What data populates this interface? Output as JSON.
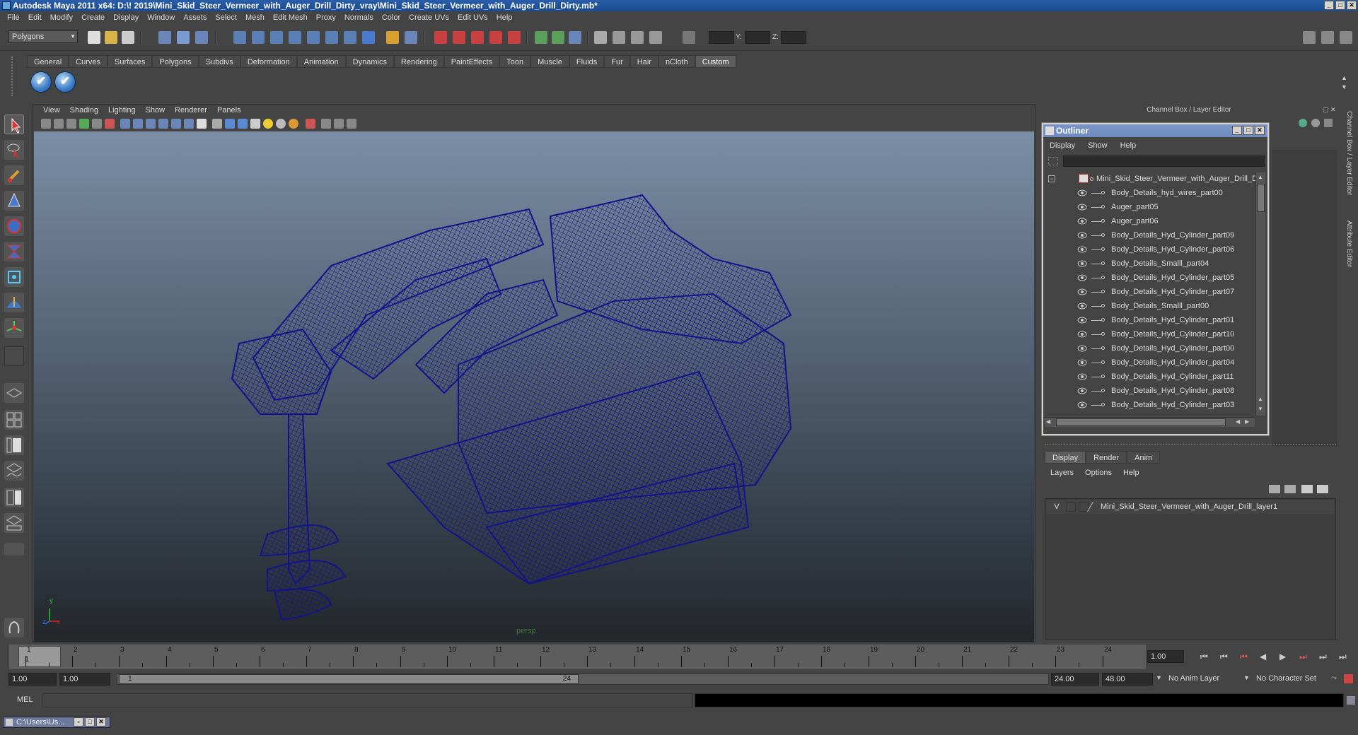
{
  "window": {
    "title": "Autodesk Maya 2011 x64: D:\\! 2019\\Mini_Skid_Steer_Vermeer_with_Auger_Drill_Dirty_vray\\Mini_Skid_Steer_Vermeer_with_Auger_Drill_Dirty.mb*"
  },
  "menubar": [
    "File",
    "Edit",
    "Modify",
    "Create",
    "Display",
    "Window",
    "Assets",
    "Select",
    "Mesh",
    "Edit Mesh",
    "Proxy",
    "Normals",
    "Color",
    "Create UVs",
    "Edit UVs",
    "Help"
  ],
  "statusline": {
    "mode": "Polygons",
    "x_label": "X:",
    "y_label": "Y:",
    "z_label": "Z:"
  },
  "shelf": {
    "tabs": [
      "General",
      "Curves",
      "Surfaces",
      "Polygons",
      "Subdivs",
      "Deformation",
      "Animation",
      "Dynamics",
      "Rendering",
      "PaintEffects",
      "Toon",
      "Muscle",
      "Fluids",
      "Fur",
      "Hair",
      "nCloth",
      "Custom"
    ],
    "active_tab": "Custom"
  },
  "viewport": {
    "menu": [
      "View",
      "Shading",
      "Lighting",
      "Show",
      "Renderer",
      "Panels"
    ],
    "camera_label": "persp",
    "axis_y": "y",
    "axis_z": "z",
    "axis_x": "x",
    "wire_color": "#14148a"
  },
  "channel_box": {
    "header": "Channel Box / Layer Editor"
  },
  "outliner": {
    "title": "Outliner",
    "menu": [
      "Display",
      "Show",
      "Help"
    ],
    "root": "Mini_Skid_Steer_Vermeer_with_Auger_Drill_Di",
    "items": [
      "Body_Details_hyd_wires_part00",
      "Auger_part05",
      "Auger_part06",
      "Body_Details_Hyd_Cylinder_part09",
      "Body_Details_Hyd_Cylinder_part06",
      "Body_Details_Smalll_part04",
      "Body_Details_Hyd_Cylinder_part05",
      "Body_Details_Hyd_Cylinder_part07",
      "Body_Details_Smalll_part00",
      "Body_Details_Hyd_Cylinder_part01",
      "Body_Details_Hyd_Cylinder_part10",
      "Body_Details_Hyd_Cylinder_part00",
      "Body_Details_Hyd_Cylinder_part04",
      "Body_Details_Hyd_Cylinder_part11",
      "Body_Details_Hyd_Cylinder_part08",
      "Body_Details_Hyd_Cylinder_part03"
    ]
  },
  "layer_editor": {
    "tabs": [
      "Display",
      "Render",
      "Anim"
    ],
    "active_tab": "Display",
    "menu": [
      "Layers",
      "Options",
      "Help"
    ],
    "layer_visible": "V",
    "layer_name": "Mini_Skid_Steer_Vermeer_with_Auger_Drill_layer1"
  },
  "side_tabs": {
    "channel_box": "Channel Box / Layer Editor",
    "attribute_editor": "Attribute Editor"
  },
  "timeline": {
    "frames": [
      "1",
      "2",
      "3",
      "4",
      "5",
      "6",
      "7",
      "8",
      "9",
      "10",
      "11",
      "12",
      "13",
      "14",
      "15",
      "16",
      "17",
      "18",
      "19",
      "20",
      "21",
      "22",
      "23",
      "24"
    ],
    "current_frame_marker": "1",
    "current_time": "1.00"
  },
  "range": {
    "start": "1.00",
    "playback_start": "1.00",
    "handle_start": "1",
    "handle_end": "24",
    "playback_end": "24.00",
    "end": "48.00",
    "anim_layer": "No Anim Layer",
    "character_set": "No Character Set"
  },
  "command_line": {
    "label": "MEL"
  },
  "taskbar": {
    "item": "C:\\Users\\Us..."
  }
}
